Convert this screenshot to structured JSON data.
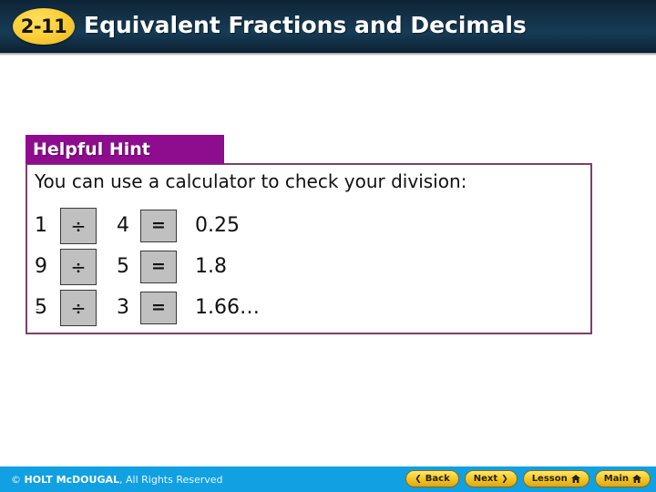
{
  "header": {
    "lesson_number": "2-11",
    "title": "Equivalent Fractions and Decimals"
  },
  "hint": {
    "title": "Helpful Hint",
    "body_text": "You can use a calculator to check your division:",
    "stray_marks": "¨",
    "rows": [
      {
        "dividend": "1",
        "divide_key": "÷",
        "divisor": "4",
        "equals_key": "=",
        "result": "0.25"
      },
      {
        "dividend": "9",
        "divide_key": "÷",
        "divisor": "5",
        "equals_key": "=",
        "result": "1.8"
      },
      {
        "dividend": "5",
        "divide_key": "÷",
        "divisor": "3",
        "equals_key": "=",
        "result": "1.66…"
      }
    ]
  },
  "footer": {
    "copyright_mark": "© ",
    "copyright_brand": "HOLT McDOUGAL",
    "copyright_rest": ", All Rights Reserved",
    "buttons": [
      {
        "label": "Back",
        "icon": "chevron-left-icon",
        "glyph": "❮",
        "icon_side": "left"
      },
      {
        "label": "Next",
        "icon": "chevron-right-icon",
        "glyph": "❯",
        "icon_side": "right"
      },
      {
        "label": "Lesson",
        "icon": "home-icon",
        "glyph": "home",
        "icon_side": "right"
      },
      {
        "label": "Main",
        "icon": "home-icon",
        "glyph": "home",
        "icon_side": "right"
      }
    ]
  },
  "colors": {
    "header_navy": "#14334a",
    "badge_gold": "#fcd03a",
    "hint_purple": "#8e0d8e",
    "hint_border": "#7b4168",
    "footer_blue": "#11a0e2",
    "key_gray": "#c0c0c0",
    "nav_button_gold": "#f4c92b"
  }
}
